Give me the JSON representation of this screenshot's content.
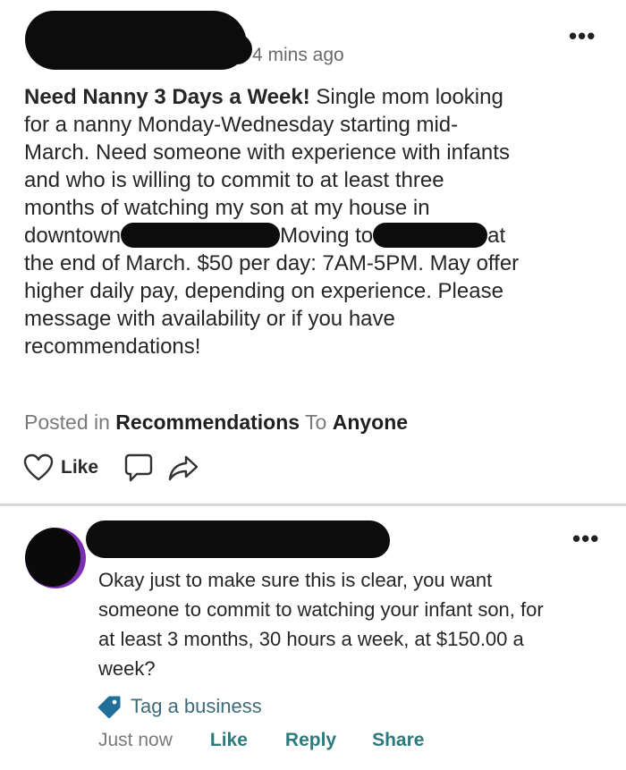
{
  "post": {
    "timestamp": "4 mins ago",
    "title": "Need Nanny 3 Days a Week!",
    "body": {
      "l1": "Single mom looking",
      "l2": "for a nanny Monday-Wednesday starting mid-",
      "l3": "March. Need someone with experience with infants",
      "l4": "and who is willing to commit to at least three",
      "l5": "months of watching my son at my house in",
      "l6a": "downtown",
      "l6b": "Moving to",
      "l6c": "at",
      "l7": "the end of March. $50 per day: 7AM-5PM. May offer",
      "l8": "higher daily pay, depending on experience. Please",
      "l9": "message with availability or if you have",
      "l10": "recommendations!"
    },
    "posted_in_label": "Posted in",
    "category": "Recommendations",
    "to_label": "To",
    "audience": "Anyone",
    "like_label": "Like",
    "more_label": "•••"
  },
  "comment": {
    "lines": [
      "Okay just to make sure this is clear, you want",
      "someone to commit to watching your infant son, for",
      "at least 3 months, 30 hours a week, at $150.00 a",
      "week?"
    ],
    "tag_label": "Tag a business",
    "time": "Just now",
    "like_label": "Like",
    "reply_label": "Reply",
    "share_label": "Share",
    "more_label": "•••"
  },
  "colors": {
    "text": "#262626",
    "muted": "#7a7a7a",
    "link": "#2c7a7b",
    "tag": "#3d6b7a",
    "avatar_ring": "#7a2fb0",
    "redaction": "#0c0c0c"
  },
  "icons": {
    "post_actions": [
      "heart-icon",
      "comment-icon",
      "share-icon"
    ],
    "comment_tag": "tag-icon"
  }
}
